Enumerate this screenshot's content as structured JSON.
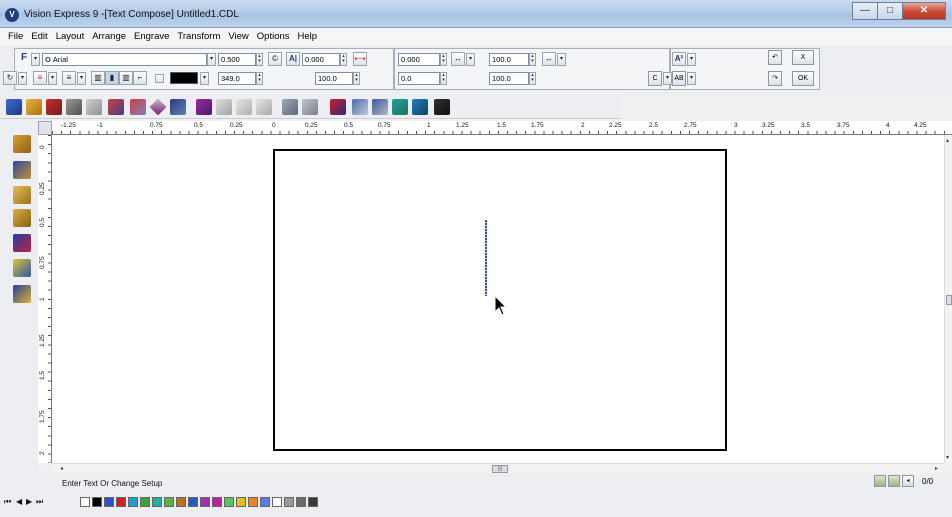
{
  "window": {
    "title": "Vision Express 9 -[Text Compose] Untitled1.CDL",
    "app_icon": "vision-express-logo-icon",
    "controls": [
      "minimize-icon",
      "maximize-icon",
      "close-icon"
    ]
  },
  "menu": [
    "File",
    "Edit",
    "Layout",
    "Arrange",
    "Engrave",
    "Transform",
    "View",
    "Options",
    "Help"
  ],
  "property_bar": {
    "font_name": "Arial",
    "font_flag": "F",
    "size": "0.500",
    "spacing": "0.000",
    "width_percent": "100.0",
    "angle": "349.0",
    "height_percent": "100.0",
    "x_offset": "0.000",
    "y_offset": "0.0",
    "h_scale": "100.0",
    "v_scale": "100.0",
    "line_color": "F",
    "c_label": "C",
    "ab_label": "AB",
    "undo_glyph": "↶",
    "redo_glyph": "↷",
    "cancel_label": "X",
    "ok_label": "OK"
  },
  "toolbar_icons": [
    "open-icon",
    "pen-icon",
    "node-icon",
    "group-icon",
    "print-icon",
    "layers-icon",
    "undo-icon",
    "diamond-icon",
    "doc-icon",
    "cube-icon",
    "star-icon",
    "star-outline-icon",
    "mirror-icon",
    "grid-icon",
    "grid2-icon",
    "scissors-icon",
    "node-edit-icon",
    "node-add-icon",
    "bend-icon",
    "monitor-icon",
    "move-icon"
  ],
  "tools": [
    "pointer-icon",
    "node-tool-icon",
    "text-tool-icon",
    "zoom-tool-icon",
    "shape-tool-icon",
    "pencil-icon",
    "fill-pen-icon"
  ],
  "ruler": {
    "h_ticks": [
      "-1.25",
      "-1",
      "0.75",
      "0.5",
      "0.25",
      "0",
      "0.25",
      "0.5",
      "0.75",
      "1",
      "1.25",
      "1.5",
      "1.75",
      "2",
      "2.25",
      "2.5",
      "2.75",
      "3",
      "3.25",
      "3.5",
      "3.75",
      "4",
      "4.25"
    ],
    "v_ticks": [
      "0",
      "0.25",
      "0.5",
      "0.75",
      "1",
      "1.25",
      "1.5",
      "1.75",
      "2"
    ]
  },
  "status": {
    "message": "Enter Text Or Change Setup",
    "page_count": "0/0"
  },
  "palette": {
    "nav": [
      "⏮",
      "◀",
      "▶",
      "⏭"
    ],
    "colors": [
      "#ffffff",
      "#000000",
      "#3050c8",
      "#d02020",
      "#20a0d0",
      "#40a040",
      "#20b0a0",
      "#60b040",
      "#c07020",
      "#2060c0",
      "#a030b0",
      "#c020a0",
      "#60c060",
      "#e0c020",
      "#f08030",
      "#5080e0",
      "#ffffff",
      "#9a9a9a",
      "#6a6a6a",
      "#3a3a3a"
    ]
  }
}
